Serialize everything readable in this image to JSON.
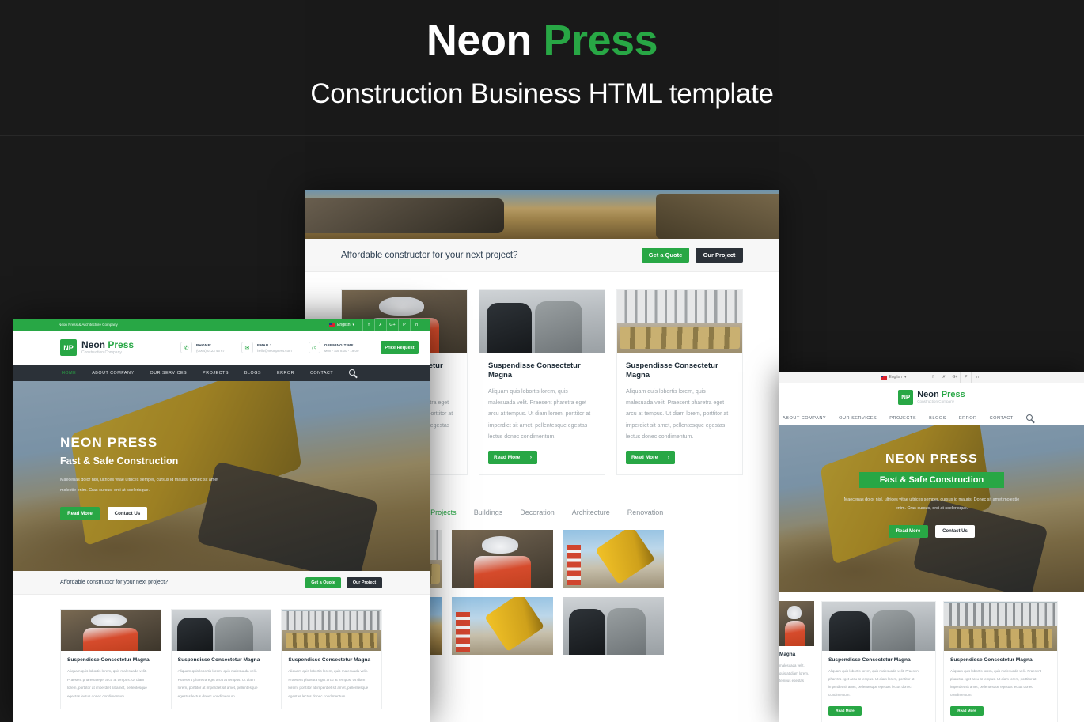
{
  "banner": {
    "title_part1": "Neon",
    "title_part2": "Press",
    "subtitle": "Construction Business HTML template",
    "accent_color": "#28a745",
    "background_color": "#1a1a1a"
  },
  "site": {
    "topbar": {
      "tagline": "Neon Press & Architecture Company",
      "language": "English",
      "language_caret": "▾",
      "social": [
        {
          "name": "facebook",
          "glyph": "f"
        },
        {
          "name": "twitter",
          "glyph": "🐦"
        },
        {
          "name": "google-plus",
          "glyph": "G+"
        },
        {
          "name": "pinterest",
          "glyph": "P"
        },
        {
          "name": "linkedin",
          "glyph": "in"
        }
      ]
    },
    "logo": {
      "mark": "NP",
      "name_part1": "Neon ",
      "name_part2": "Press",
      "tagline": "Construction Company"
    },
    "info": [
      {
        "icon": "phone-icon",
        "label": "PHONE:",
        "value": "(0064) 0123 45 67"
      },
      {
        "icon": "mail-icon",
        "label": "EMAIL:",
        "value": "hello@neonpress.com"
      },
      {
        "icon": "clock-icon",
        "label": "OPENING TIME:",
        "value": "Mon - Sat 8:00 - 19:00"
      }
    ],
    "price_request_label": "Price Request",
    "nav": [
      {
        "label": "HOME",
        "active": true
      },
      {
        "label": "ABOUT COMPANY",
        "active": false
      },
      {
        "label": "OUR SERVICES",
        "active": false
      },
      {
        "label": "PROJECTS",
        "active": false
      },
      {
        "label": "BLOGS",
        "active": false
      },
      {
        "label": "ERROR",
        "active": false
      },
      {
        "label": "CONTACT",
        "active": false
      }
    ],
    "search_icon": "search-icon",
    "hero": {
      "title": "NEON PRESS",
      "subtitle": "Fast & Safe Construction",
      "paragraph": "Maecenas dolor nisl, ultrices vitae ultrices semper, cursus id mauris. Donec sit amet molestie enim. Cras cursus, orci at scelerisque.",
      "btn_primary": "Read More",
      "btn_secondary": "Contact Us"
    },
    "cta": {
      "text": "Affordable constructor for your next project?",
      "btn_primary": "Get a Quote",
      "btn_secondary": "Our Project"
    },
    "cards": [
      {
        "image": "worker-blueprint",
        "title": "Suspendisse Consectetur Magna",
        "body": "Aliquam quis lobortis lorem, quis malesuada velit. Praesent pharetra eget arcu at tempus. Ut diam lorem, porttitor at imperdiet sit amet, pellentesque egestas lectus donec condimentum.",
        "btn": "Read More"
      },
      {
        "image": "two-engineers",
        "title": "Suspendisse Consectetur Magna",
        "body": "Aliquam quis lobortis lorem, quis malesuada velit. Praesent pharetra eget arcu at tempus. Ut diam lorem, porttitor at imperdiet sit amet, pellentesque egestas lectus donec condimentum.",
        "btn": "Read More"
      },
      {
        "image": "construction-site",
        "title": "Suspendisse Consectetur Magna",
        "body": "Aliquam quis lobortis lorem, quis malesuada velit. Praesent pharetra eget arcu at tempus. Ut diam lorem, porttitor at imperdiet sit amet, pellentesque egestas lectus donec condimentum.",
        "btn": "Read More"
      }
    ],
    "projects": {
      "filters": [
        {
          "label": "All Projects",
          "active": true
        },
        {
          "label": "Buildings",
          "active": false
        },
        {
          "label": "Decoration",
          "active": false
        },
        {
          "label": "Architecture",
          "active": false
        },
        {
          "label": "Renovation",
          "active": false
        }
      ],
      "items": [
        {
          "image": "construction-site"
        },
        {
          "image": "worker-blueprint"
        },
        {
          "image": "excavator-road"
        },
        {
          "image": "excavator-digging"
        },
        {
          "image": "crane-site"
        },
        {
          "image": "two-engineers"
        }
      ]
    }
  }
}
